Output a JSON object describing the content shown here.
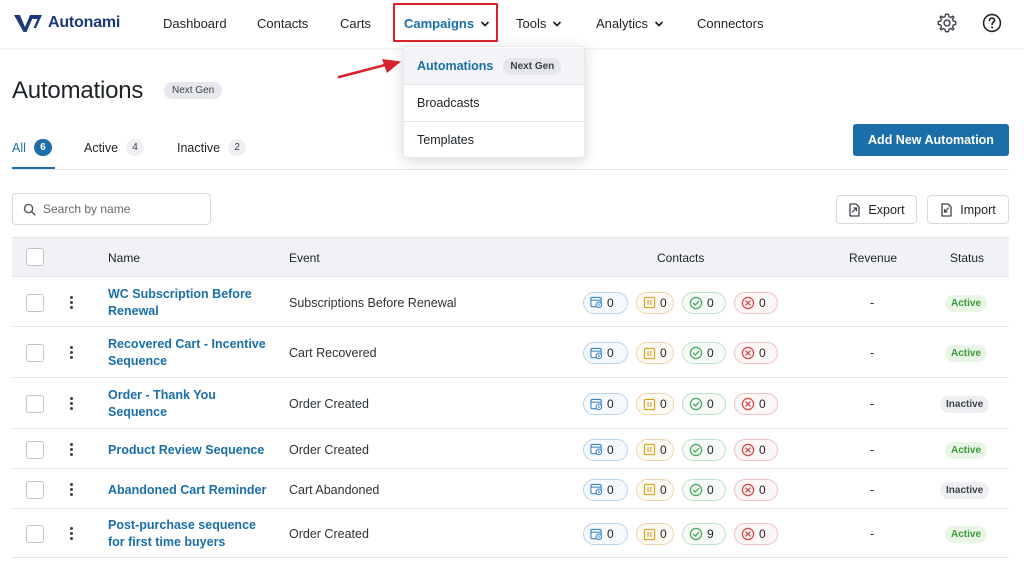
{
  "brand": {
    "name": "Autonami"
  },
  "nav": {
    "items": [
      "Dashboard",
      "Contacts",
      "Carts",
      "Campaigns",
      "Tools",
      "Analytics",
      "Connectors"
    ]
  },
  "dropdown": {
    "items": [
      {
        "label": "Automations",
        "badge": "Next Gen"
      },
      {
        "label": "Broadcasts"
      },
      {
        "label": "Templates"
      }
    ]
  },
  "page": {
    "title": "Automations",
    "title_badge": "Next Gen",
    "add_button": "Add New Automation"
  },
  "tabs": [
    {
      "label": "All",
      "count": "6"
    },
    {
      "label": "Active",
      "count": "4"
    },
    {
      "label": "Inactive",
      "count": "2"
    }
  ],
  "search": {
    "placeholder": "Search by name"
  },
  "actions": {
    "export": "Export",
    "import": "Import"
  },
  "table": {
    "headers": {
      "name": "Name",
      "event": "Event",
      "contacts": "Contacts",
      "revenue": "Revenue",
      "status": "Status"
    },
    "rows": [
      {
        "name": "WC Subscription Before Renewal",
        "event": "Subscriptions Before Renewal",
        "contacts": [
          "0",
          "0",
          "0",
          "0"
        ],
        "revenue": "-",
        "status": "Active"
      },
      {
        "name": "Recovered Cart - Incentive Sequence",
        "event": "Cart Recovered",
        "contacts": [
          "0",
          "0",
          "0",
          "0"
        ],
        "revenue": "-",
        "status": "Active"
      },
      {
        "name": "Order - Thank You Sequence",
        "event": "Order Created",
        "contacts": [
          "0",
          "0",
          "0",
          "0"
        ],
        "revenue": "-",
        "status": "Inactive"
      },
      {
        "name": "Product Review Sequence",
        "event": "Order Created",
        "contacts": [
          "0",
          "0",
          "0",
          "0"
        ],
        "revenue": "-",
        "status": "Active"
      },
      {
        "name": "Abandoned Cart Reminder",
        "event": "Cart Abandoned",
        "contacts": [
          "0",
          "0",
          "0",
          "0"
        ],
        "revenue": "-",
        "status": "Inactive"
      },
      {
        "name": "Post-purchase sequence for first time buyers",
        "event": "Order Created",
        "contacts": [
          "0",
          "0",
          "9",
          "0"
        ],
        "revenue": "-",
        "status": "Active"
      }
    ]
  },
  "colors": {
    "accent": "#1a6fa8",
    "brand": "#1d3a7a",
    "highlight": "#d8232a",
    "active": "#3c9a3c"
  },
  "icons": {
    "nav": [
      "chevron-down-icon",
      "settings-gear-icon",
      "help-question-icon"
    ],
    "contacts": [
      "contacts-queued-icon",
      "paused-icon",
      "completed-check-icon",
      "failed-x-icon"
    ]
  }
}
